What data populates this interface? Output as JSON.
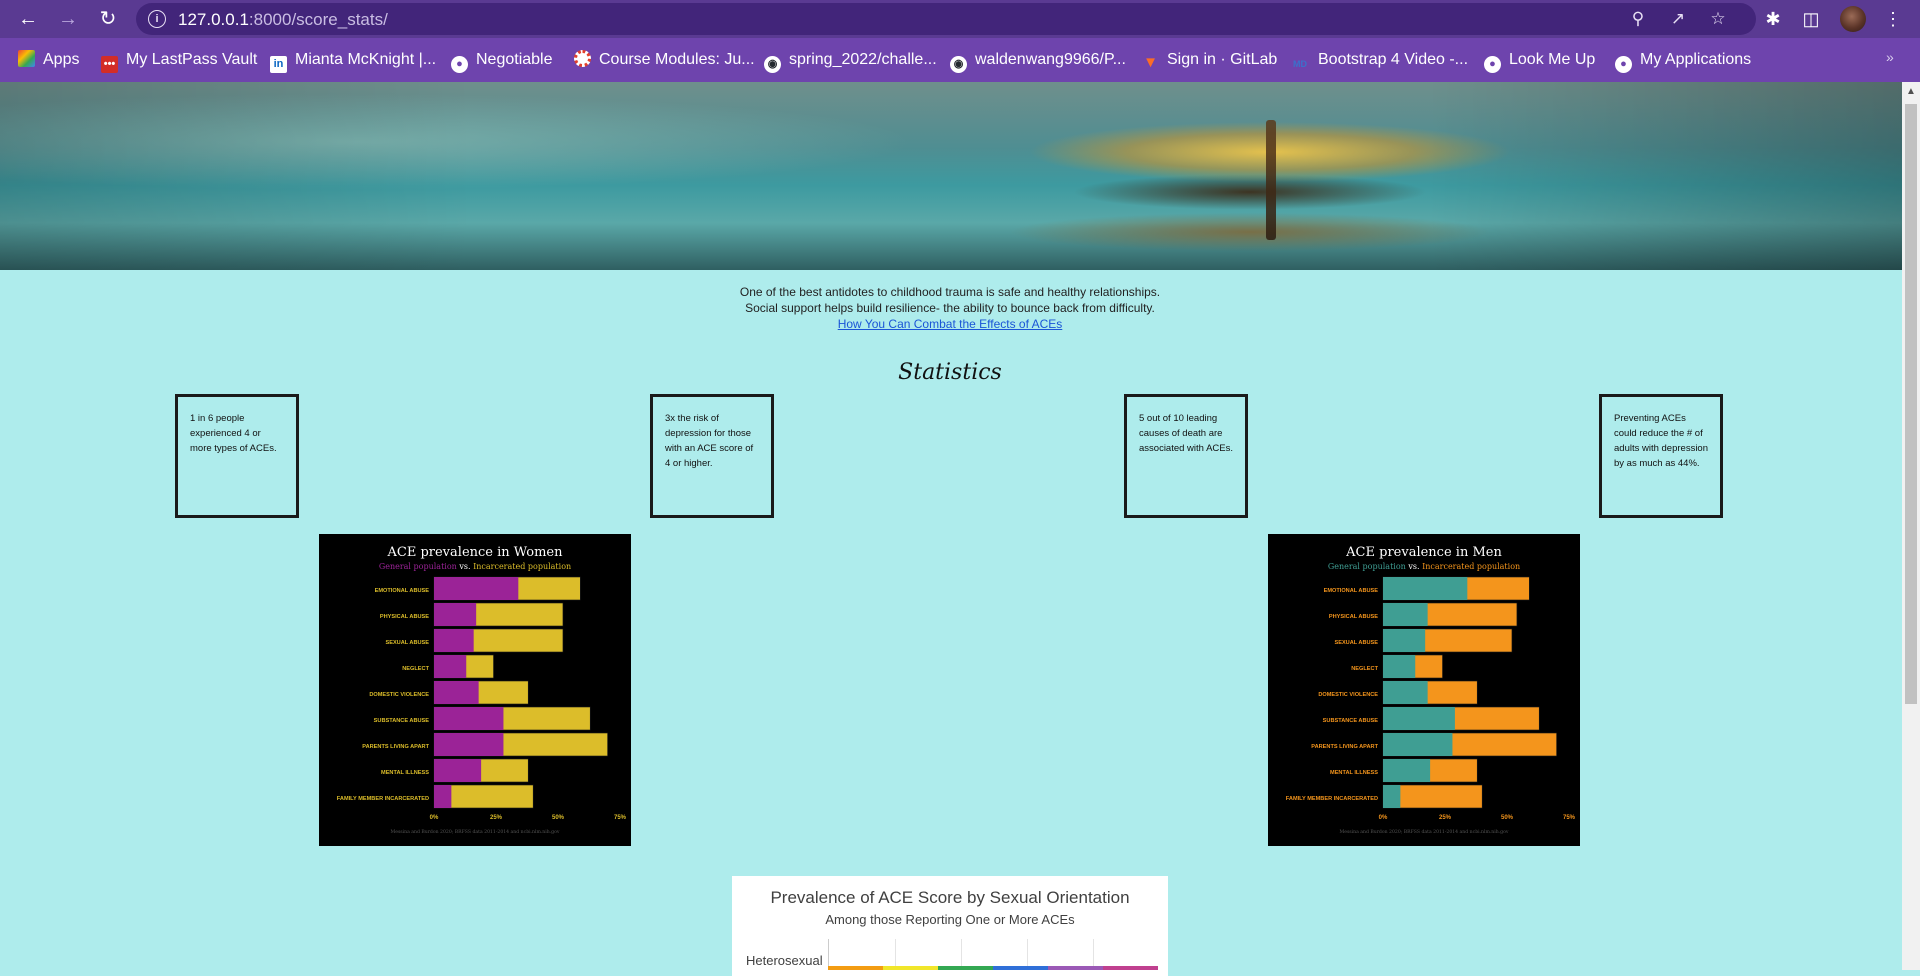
{
  "browser": {
    "url_host": "127.0.0.1",
    "url_rest": ":8000/score_stats/",
    "bookmarks": [
      {
        "label": "Apps",
        "icon": "apps-grid-icon",
        "color": "#e8493b"
      },
      {
        "label": "My LastPass Vault",
        "icon": "lastpass-icon",
        "color": "#d32d27"
      },
      {
        "label": "Mianta McKnight |...",
        "icon": "linkedin-icon",
        "color": "#0a66c2"
      },
      {
        "label": "Negotiable",
        "icon": "globe-icon",
        "color": "#ffffff"
      },
      {
        "label": "Course Modules: Ju...",
        "icon": "canvas-icon",
        "color": "#e13f2b"
      },
      {
        "label": "spring_2022/challe...",
        "icon": "github-icon",
        "color": "#ffffff"
      },
      {
        "label": "waldenwang9966/P...",
        "icon": "github-icon",
        "color": "#ffffff"
      },
      {
        "label": "Sign in · GitLab",
        "icon": "gitlab-icon",
        "color": "#fc6d26"
      },
      {
        "label": "Bootstrap 4 Video -...",
        "icon": "mdb-icon",
        "color": "#3b71ca"
      },
      {
        "label": "Look Me Up",
        "icon": "globe-icon",
        "color": "#ffffff"
      },
      {
        "label": "My Applications",
        "icon": "globe-icon",
        "color": "#ffffff"
      }
    ]
  },
  "intro": {
    "line1": "One of the best antidotes to childhood trauma is safe and healthy relationships.",
    "line2": "Social support helps build resilience- the ability to bounce back from difficulty.",
    "link": "How You Can Combat the Effects of ACEs"
  },
  "stats_title": "Statistics",
  "stats": [
    "1 in 6 people experienced 4 or more types of ACEs.",
    "3x the risk of depression for those with an ACE score of 4 or higher.",
    "5 out of 10 leading causes of death are associated with ACEs.",
    "Preventing ACEs could reduce the # of adults with depression by as much as 44%."
  ],
  "chart_data": [
    {
      "type": "bar",
      "title": "ACE prevalence in Women",
      "subtitle_a": "General population",
      "subtitle_vs": "vs.",
      "subtitle_b": "Incarcerated population",
      "categories": [
        "EMOTIONAL ABUSE",
        "PHYSICAL ABUSE",
        "SEXUAL ABUSE",
        "NEGLECT",
        "DOMESTIC VIOLENCE",
        "SUBSTANCE ABUSE",
        "PARENTS LIVING APART",
        "MENTAL ILLNESS",
        "FAMILY MEMBER INCARCERATED"
      ],
      "series": [
        {
          "name": "General population",
          "color": "#9b2397",
          "values": [
            34,
            17,
            16,
            13,
            18,
            28,
            28,
            19,
            7
          ]
        },
        {
          "name": "Incarcerated population",
          "color": "#dcbd2a",
          "values": [
            59,
            52,
            52,
            24,
            38,
            63,
            70,
            38,
            40
          ]
        }
      ],
      "ticks": [
        "0%",
        "25%",
        "50%",
        "75%"
      ],
      "ylim": [
        0,
        75
      ],
      "source": "Messina and Burdon 2020; BRFSS data 2011-2014 and ncbi.nlm.nih.gov"
    },
    {
      "type": "bar",
      "title": "ACE prevalence in Men",
      "subtitle_a": "General population",
      "subtitle_vs": "vs.",
      "subtitle_b": "Incarcerated population",
      "categories": [
        "EMOTIONAL ABUSE",
        "PHYSICAL ABUSE",
        "SEXUAL ABUSE",
        "NEGLECT",
        "DOMESTIC VIOLENCE",
        "SUBSTANCE ABUSE",
        "PARENTS LIVING APART",
        "MENTAL ILLNESS",
        "FAMILY MEMBER INCARCERATED"
      ],
      "series": [
        {
          "name": "General population",
          "color": "#3f9e93",
          "values": [
            34,
            18,
            17,
            13,
            18,
            29,
            28,
            19,
            7
          ]
        },
        {
          "name": "Incarcerated population",
          "color": "#f4951c",
          "values": [
            59,
            54,
            52,
            24,
            38,
            63,
            70,
            38,
            40
          ]
        }
      ],
      "ticks": [
        "0%",
        "25%",
        "50%",
        "75%"
      ],
      "ylim": [
        0,
        75
      ],
      "source": "Messina and Burdon 2020; BRFSS data 2011-2014 and ncbi.nlm.nih.gov"
    }
  ],
  "orientation_chart": {
    "title": "Prevalence of ACE Score by Sexual Orientation",
    "subtitle": "Among those Reporting One or More ACEs",
    "row_label": "Heterosexual",
    "colors": [
      "#f39c12",
      "#f1e62a",
      "#34a853",
      "#2f6fd8",
      "#9b59b6",
      "#c0408f"
    ]
  }
}
